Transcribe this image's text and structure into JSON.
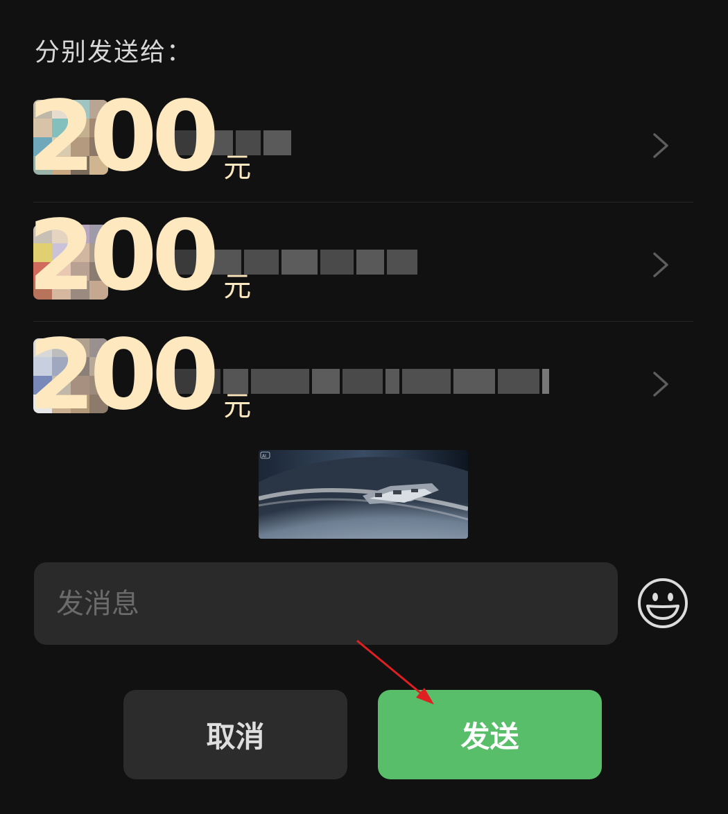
{
  "header": {
    "title": "分别发送给："
  },
  "recipients": [
    {
      "amount": "200",
      "unit": "元"
    },
    {
      "amount": "200",
      "unit": "元"
    },
    {
      "amount": "200",
      "unit": "元"
    }
  ],
  "attachment": {
    "badge": "AI"
  },
  "message": {
    "placeholder": "发消息",
    "value": ""
  },
  "actions": {
    "cancel_label": "取消",
    "send_label": "发送"
  },
  "colors": {
    "background": "#111111",
    "amount": "#fde8c0",
    "send_button": "#58be6a",
    "cancel_button": "#2c2c2c",
    "annotation_arrow": "#e02020"
  }
}
